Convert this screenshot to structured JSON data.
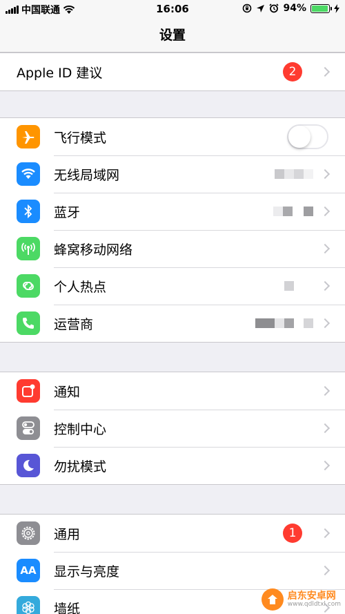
{
  "status_bar": {
    "carrier": "中国联通",
    "time": "16:06",
    "battery": "94%",
    "battery_level": 0.94
  },
  "nav": {
    "title": "设置"
  },
  "apple_id": {
    "label": "Apple ID 建议",
    "badge": "2"
  },
  "network_group": [
    {
      "label": "飞行模式",
      "icon": "airplane-icon",
      "color": "#ff9500"
    },
    {
      "label": "无线局域网",
      "icon": "wifi-icon",
      "color": "#1a8cff"
    },
    {
      "label": "蓝牙",
      "icon": "bluetooth-icon",
      "color": "#1a8cff"
    },
    {
      "label": "蜂窝移动网络",
      "icon": "antenna-icon",
      "color": "#4cd964"
    },
    {
      "label": "个人热点",
      "icon": "hotspot-icon",
      "color": "#4cd964"
    },
    {
      "label": "运营商",
      "icon": "phone-icon",
      "color": "#4cd964"
    }
  ],
  "notify_group": [
    {
      "label": "通知",
      "icon": "notification-icon",
      "color": "#ff3b30"
    },
    {
      "label": "控制中心",
      "icon": "switches-icon",
      "color": "#8e8e93"
    },
    {
      "label": "勿扰模式",
      "icon": "moon-icon",
      "color": "#5856d6"
    }
  ],
  "general_group": [
    {
      "label": "通用",
      "icon": "gear-icon",
      "color": "#8e8e93",
      "badge": "1"
    },
    {
      "label": "显示与亮度",
      "icon": "display-icon",
      "color": "#1a8cff",
      "icon_text": "AA"
    },
    {
      "label": "墙纸",
      "icon": "flower-icon",
      "color": "#34aadc"
    }
  ],
  "watermark": {
    "title": "启东安卓网",
    "url": "www.qdldtxl.com"
  }
}
